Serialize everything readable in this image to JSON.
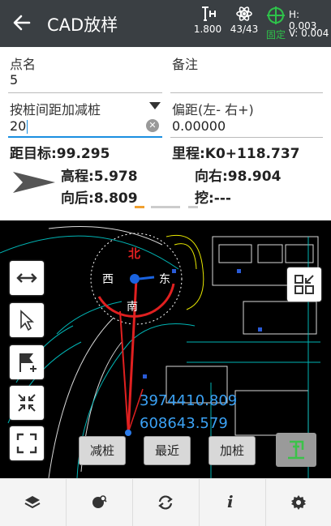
{
  "header": {
    "title": "CAD放样",
    "antenna_height": "1.800",
    "satellites": "43/43",
    "solution": "固定",
    "h_precision": "H: 0.003",
    "v_precision": "V: 0.004"
  },
  "form": {
    "point_name_label": "点名",
    "point_name_value": "5",
    "remark_label": "备注",
    "remark_value": "",
    "stake_label": "按桩间距加减桩",
    "stake_value": "20",
    "offset_label": "偏距(左- 右+)",
    "offset_value": "0.00000",
    "clear_glyph": "✕"
  },
  "readout": {
    "target_distance": "距目标:99.295",
    "mileage": "里程:K0+118.737",
    "elevation": "高程:5.978",
    "right": "向右:98.904",
    "backward": "向后:8.809",
    "cut": "挖:---"
  },
  "map": {
    "north_label": "北",
    "south_label": "南",
    "east_label": "东",
    "west_label": "西",
    "coord_north": "3974410.809",
    "coord_east": "608643.579",
    "minus_stake": "减桩",
    "nearest": "最近",
    "plus_stake": "加桩"
  },
  "colors": {
    "header_bg": "#3a3f43",
    "fix_green": "#2ec24a",
    "accent_blue": "#1a8fe0",
    "coord_blue": "#3ba2f5",
    "guide_red": "#e02020"
  },
  "icons": {
    "back": "back-arrow-icon",
    "antenna": "antenna-height-icon",
    "satellite": "satellite-icon",
    "gps": "gps-crosshair-icon",
    "layers": "layers-icon",
    "search_map": "map-search-icon",
    "refresh": "refresh-icon",
    "info": "info-icon",
    "settings": "gear-icon"
  },
  "bottom": {
    "info_glyph": "i"
  }
}
